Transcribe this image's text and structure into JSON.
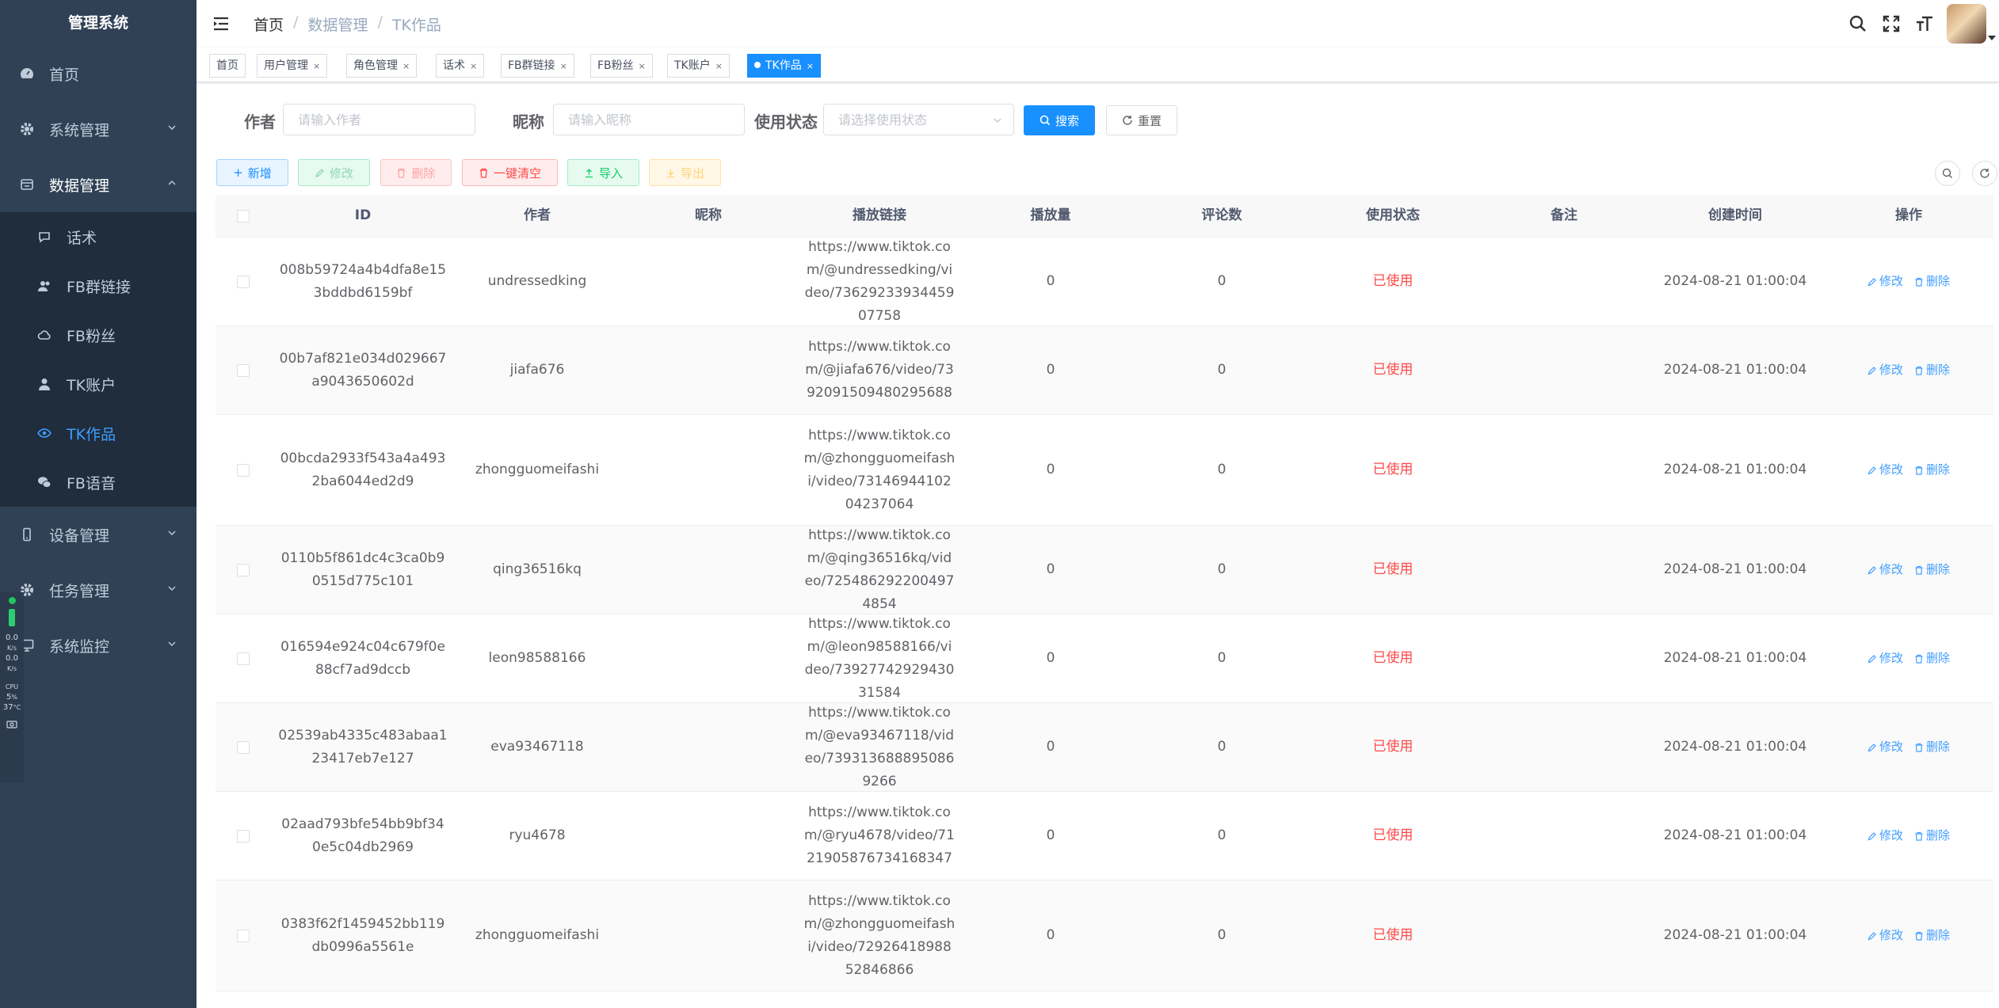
{
  "app": {
    "title": "管理系统"
  },
  "sidebar": {
    "items": [
      {
        "label": "首页",
        "icon": "dashboard-icon"
      },
      {
        "label": "系统管理",
        "icon": "gear-icon"
      },
      {
        "label": "数据管理",
        "icon": "database-icon",
        "expanded": true
      },
      {
        "label": "设备管理",
        "icon": "phone-icon"
      },
      {
        "label": "任务管理",
        "icon": "gear-icon"
      },
      {
        "label": "系统监控",
        "icon": "monitor-icon"
      }
    ],
    "sub_items": [
      {
        "label": "话术",
        "icon": "chat-icon"
      },
      {
        "label": "FB群链接",
        "icon": "group-icon"
      },
      {
        "label": "FB粉丝",
        "icon": "cloud-icon"
      },
      {
        "label": "TK账户",
        "icon": "user-icon"
      },
      {
        "label": "TK作品",
        "icon": "eye-icon",
        "active": true
      },
      {
        "label": "FB语音",
        "icon": "wechat-icon"
      }
    ],
    "active_color": "#409eff"
  },
  "monitor": {
    "up": "0.0",
    "up_unit": "K/s",
    "down": "0.0",
    "down_unit": "K/s",
    "cpu_label": "CPU",
    "cpu": "5",
    "cpu_unit": "%",
    "temp": "37",
    "temp_unit": "°C"
  },
  "header": {
    "breadcrumb": [
      "首页",
      "数据管理",
      "TK作品"
    ],
    "separator": "/"
  },
  "tags": [
    {
      "label": "首页",
      "closable": false
    },
    {
      "label": "用户管理",
      "closable": true
    },
    {
      "label": "角色管理",
      "closable": true
    },
    {
      "label": "话术",
      "closable": true
    },
    {
      "label": "FB群链接",
      "closable": true
    },
    {
      "label": "FB粉丝",
      "closable": true
    },
    {
      "label": "TK账户",
      "closable": true
    },
    {
      "label": "TK作品",
      "closable": true,
      "active": true
    }
  ],
  "tag_close": "×",
  "search": {
    "author_label": "作者",
    "author_placeholder": "请输入作者",
    "nickname_label": "昵称",
    "nickname_placeholder": "请输入昵称",
    "status_label": "使用状态",
    "status_placeholder": "请选择使用状态",
    "search_button": "搜索",
    "reset_button": "重置"
  },
  "toolbar": {
    "add": "新增",
    "edit": "修改",
    "delete": "删除",
    "clear": "一键清空",
    "import": "导入",
    "export": "导出"
  },
  "table": {
    "headers": [
      "ID",
      "作者",
      "昵称",
      "播放链接",
      "播放量",
      "评论数",
      "使用状态",
      "备注",
      "创建时间",
      "操作"
    ],
    "edit_label": "修改",
    "delete_label": "删除",
    "rows": [
      {
        "id": "008b59724a4b4dfa8e153bddbd6159bf",
        "author": "undressedking",
        "nickname": "",
        "link": "https://www.tiktok.com/@undressedking/video/7362923393445907758",
        "plays": "0",
        "comments": "0",
        "status": "已使用",
        "note": "",
        "created": "2024-08-21 01:00:04"
      },
      {
        "id": "00b7af821e034d029667a9043650602d",
        "author": "jiafa676",
        "nickname": "",
        "link": "https://www.tiktok.com/@jiafa676/video/7392091509480295688",
        "plays": "0",
        "comments": "0",
        "status": "已使用",
        "note": "",
        "created": "2024-08-21 01:00:04"
      },
      {
        "id": "00bcda2933f543a4a4932ba6044ed2d9",
        "author": "zhongguomeifashi",
        "nickname": "",
        "link": "https://www.tiktok.com/@zhongguomeifashi/video/7314694410204237064",
        "plays": "0",
        "comments": "0",
        "status": "已使用",
        "note": "",
        "created": "2024-08-21 01:00:04"
      },
      {
        "id": "0110b5f861dc4c3ca0b90515d775c101",
        "author": "qing36516kq",
        "nickname": "",
        "link": "https://www.tiktok.com/@qing36516kq/video/7254862922004974854",
        "plays": "0",
        "comments": "0",
        "status": "已使用",
        "note": "",
        "created": "2024-08-21 01:00:04"
      },
      {
        "id": "016594e924c04c679f0e88cf7ad9dccb",
        "author": "leon98588166",
        "nickname": "",
        "link": "https://www.tiktok.com/@leon98588166/video/7392774292943031584",
        "plays": "0",
        "comments": "0",
        "status": "已使用",
        "note": "",
        "created": "2024-08-21 01:00:04"
      },
      {
        "id": "02539ab4335c483abaa123417eb7e127",
        "author": "eva93467118",
        "nickname": "",
        "link": "https://www.tiktok.com/@eva93467118/video/7393136888950869266",
        "plays": "0",
        "comments": "0",
        "status": "已使用",
        "note": "",
        "created": "2024-08-21 01:00:04"
      },
      {
        "id": "02aad793bfe54bb9bf340e5c04db2969",
        "author": "ryu4678",
        "nickname": "",
        "link": "https://www.tiktok.com/@ryu4678/video/7121905876734168347",
        "plays": "0",
        "comments": "0",
        "status": "已使用",
        "note": "",
        "created": "2024-08-21 01:00:04"
      },
      {
        "id": "0383f62f1459452bb119db0996a5561e",
        "author": "zhongguomeifashi",
        "nickname": "",
        "link": "https://www.tiktok.com/@zhongguomeifashi/video/7292641898852846866",
        "plays": "0",
        "comments": "0",
        "status": "已使用",
        "note": "",
        "created": "2024-08-21 01:00:04"
      }
    ]
  },
  "colors": {
    "sidebar_bg": "#304156",
    "submenu_bg": "#1f2d3d",
    "primary": "#1890ff",
    "danger": "#ff4949"
  }
}
